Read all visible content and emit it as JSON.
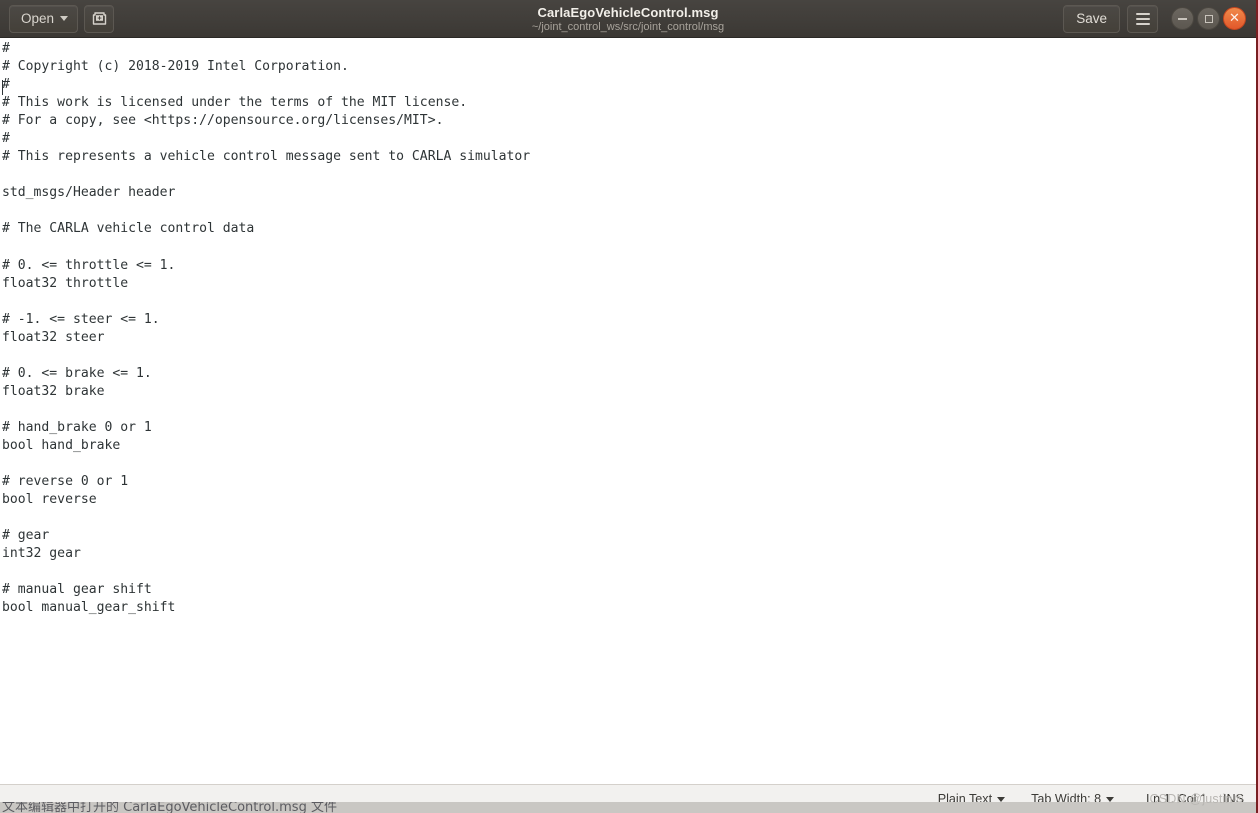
{
  "window": {
    "title": "CarlaEgoVehicleControl.msg",
    "subtitle": "~/joint_control_ws/src/joint_control/msg"
  },
  "toolbar": {
    "open_label": "Open",
    "open_icon": "chevron-down-icon",
    "saveas_icon": "save-as-icon",
    "save_label": "Save",
    "menu_icon": "hamburger-menu-icon"
  },
  "window_controls": {
    "minimize_icon": "minimize-icon",
    "maximize_icon": "maximize-icon",
    "close_icon": "close-icon",
    "close_color": "#e2572a"
  },
  "editor": {
    "content": "#\n# Copyright (c) 2018-2019 Intel Corporation.\n#\n# This work is licensed under the terms of the MIT license.\n# For a copy, see <https://opensource.org/licenses/MIT>.\n#\n# This represents a vehicle control message sent to CARLA simulator\n\nstd_msgs/Header header\n\n# The CARLA vehicle control data\n\n# 0. <= throttle <= 1.\nfloat32 throttle\n\n# -1. <= steer <= 1.\nfloat32 steer\n\n# 0. <= brake <= 1.\nfloat32 brake\n\n# hand_brake 0 or 1\nbool hand_brake\n\n# reverse 0 or 1\nbool reverse\n\n# gear\nint32 gear\n\n# manual gear shift\nbool manual_gear_shift\n",
    "text_color": "#2e3436",
    "background": "#ffffff"
  },
  "statusbar": {
    "language": "Plain Text",
    "tab_width": "Tab Width: 8",
    "position": "Ln 1, Col 1",
    "insert_mode": "INS"
  },
  "watermark": {
    "text": "CSDN @justin",
    "mark": "®"
  },
  "background_window": {
    "clipped_text": "文本编辑器中打开的 CarlaEgoVehicleControl.msg 文件"
  }
}
